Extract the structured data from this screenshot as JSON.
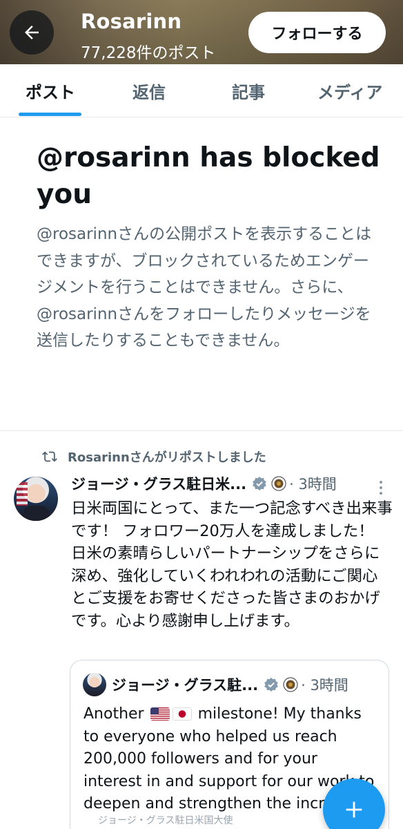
{
  "header": {
    "title": "Rosarinn",
    "post_count": "77,228件のポスト",
    "follow_label": "フォローする"
  },
  "tabs": [
    {
      "label": "ポスト",
      "active": true
    },
    {
      "label": "返信",
      "active": false
    },
    {
      "label": "記事",
      "active": false
    },
    {
      "label": "メディア",
      "active": false
    }
  ],
  "block_notice": {
    "title": "@rosarinn has blocked you",
    "description": "@rosarinnさんの公開ポストを表示することはできますが、ブロックされているためエンゲージメントを行うことはできません。さらに、@rosarinnさんをフォローしたりメッセージを送信したりすることもできません。"
  },
  "post": {
    "repost_label": "Rosarinnさんがリポストしました",
    "author": "ジョージ・グラス駐日米...",
    "time": "· 3時間",
    "text": "日米両国にとって、また一つ記念すべき出来事です！ フォロワー20万人を達成しました！ 日米の素晴らしいパートナーシップをさらに深め、強化していくわれわれの活動にご関心とご支援をお寄せくださった皆さまのおかげです。心より感謝申し上げます。",
    "quote": {
      "author": "ジョージ・グラス駐...",
      "time": "· 3時間",
      "text_before": "Another",
      "text_after": "milestone! My thanks to everyone who helped us reach 200,000 followers and for your interest in and support for our work to deepen and strengthen the incr",
      "flags": [
        "us-flag-icon",
        "jp-flag-icon"
      ],
      "cutoff_text": "ジョージ・グラス駐日米国大使"
    }
  },
  "colors": {
    "accent": "#1d9bf0",
    "text_primary": "#0f1419",
    "text_secondary": "#536471",
    "border": "#cfd9de"
  },
  "icons": {
    "back": "arrow-left-icon",
    "repost": "repost-icon",
    "verified": "verified-badge-icon",
    "seal": "embassy-seal-icon",
    "more": "more-vertical-icon",
    "fab": "plus-icon"
  }
}
